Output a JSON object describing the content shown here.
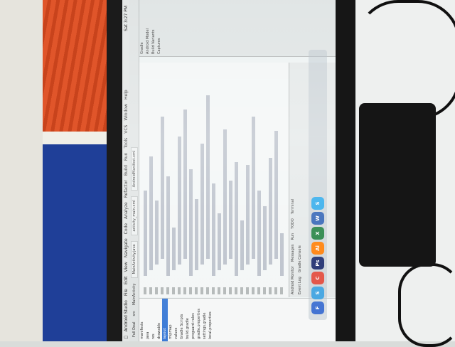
{
  "menubar": {
    "items": [
      "Android Studio",
      "File",
      "Edit",
      "View",
      "Navigate",
      "Code",
      "Analyze",
      "Refactor",
      "Build",
      "Run",
      "Tools",
      "VCS",
      "Window",
      "Help"
    ],
    "clock": "Sat 3:27 PM"
  },
  "toolbar": {
    "path": "Fb",
    "crumbs": [
      "Full Deal",
      "src",
      "MainActivity"
    ],
    "tabs": [
      "MainActivity.java",
      "activity_main.xml",
      "AndroidManifest.xml"
    ]
  },
  "sidebar": {
    "items": [
      "manifests",
      "java",
      "res",
      "drawable",
      "layout",
      "mipmap",
      "values",
      "Gradle Scripts",
      "build.gradle",
      "proguard-rules",
      "gradle.properties",
      "settings.gradle",
      "local.properties"
    ],
    "selected_index": 4
  },
  "bottom": {
    "tabs": [
      "Android Monitor",
      "Messages",
      "Run",
      "TODO",
      "Terminal"
    ],
    "status": [
      "Event Log",
      "Gradle Console"
    ]
  },
  "panel": {
    "items": [
      "Gradle",
      "Android Model",
      "Build Variants",
      "Captures"
    ]
  },
  "dock": {
    "apps": [
      {
        "label": "F",
        "color": "#3d6fd1"
      },
      {
        "label": "S",
        "color": "#3fa3e0"
      },
      {
        "label": "C",
        "color": "#e24a3b"
      },
      {
        "label": "Ps",
        "color": "#1a2a6c"
      },
      {
        "label": "Ai",
        "color": "#ff7c00"
      },
      {
        "label": "X",
        "color": "#1e7f3e"
      },
      {
        "label": "W",
        "color": "#2b5fb3"
      },
      {
        "label": "S",
        "color": "#28a8ea"
      }
    ]
  }
}
